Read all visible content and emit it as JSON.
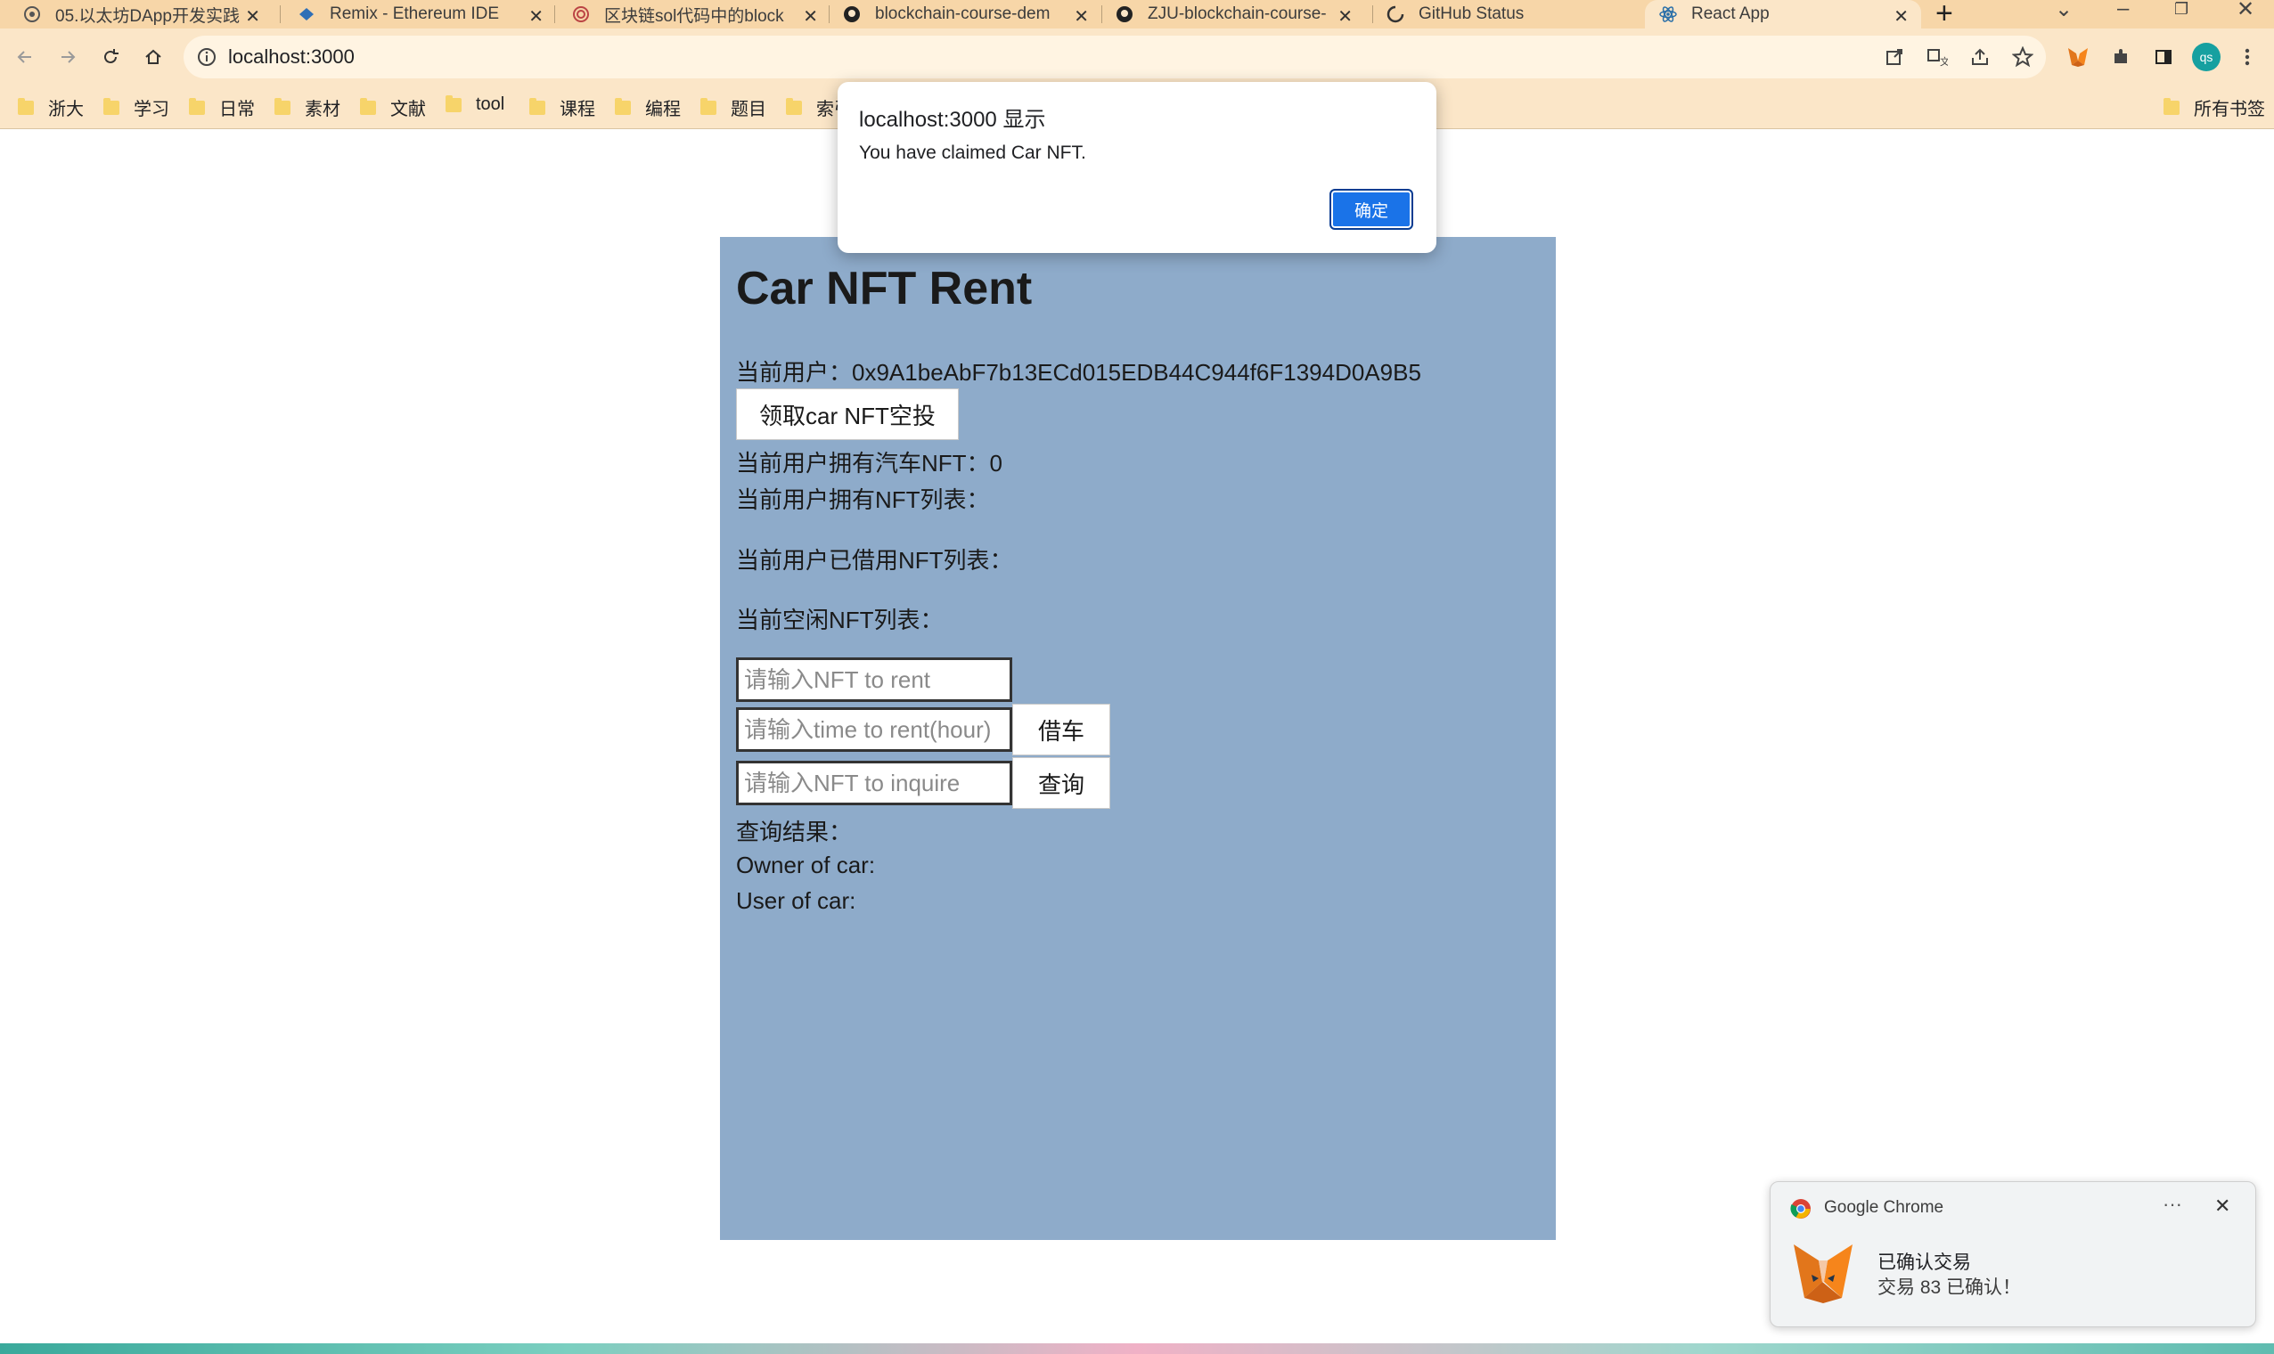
{
  "browser": {
    "tabs": [
      {
        "title": "05.以太坊DApp开发实践",
        "icon": "remix-logo-icon"
      },
      {
        "title": "Remix - Ethereum IDE",
        "icon": "remix-icon"
      },
      {
        "title": "区块链sol代码中的block",
        "icon": "spiral-icon"
      },
      {
        "title": "blockchain-course-dem",
        "icon": "github-icon"
      },
      {
        "title": "ZJU-blockchain-course-",
        "icon": "github-icon"
      },
      {
        "title": "GitHub Status",
        "icon": "github-status-icon"
      },
      {
        "title": "React App",
        "icon": "react-icon",
        "active": true
      }
    ],
    "url": "localhost:3000",
    "profile_initials": "qs",
    "bookmarks": [
      "浙大",
      "学习",
      "日常",
      "素材",
      "文献",
      "tool",
      "课程",
      "编程",
      "题目",
      "索引"
    ],
    "all_bookmarks_label": "所有书签"
  },
  "app": {
    "title": "Car NFT Rent",
    "current_user_label": "当前用户：",
    "current_user_address": "0x9A1beAbF7b13ECd015EDB44C944f6F1394D0A9B5",
    "claim_button": "领取car NFT空投",
    "owned_count_label": "当前用户拥有汽车NFT：",
    "owned_count": "0",
    "owned_list_label": "当前用户拥有NFT列表：",
    "borrowed_list_label": "当前用户已借用NFT列表：",
    "idle_list_label": "当前空闲NFT列表：",
    "rent_nft_placeholder": "请输入NFT to rent",
    "rent_time_placeholder": "请输入time to rent(hour)",
    "rent_button": "借车",
    "inquire_placeholder": "请输入NFT to inquire",
    "inquire_button": "查询",
    "query_result_label": "查询结果：",
    "owner_label": "Owner of car:",
    "user_label": "User of car:"
  },
  "dialog": {
    "origin": "localhost:3000 显示",
    "message": "You have claimed Car NFT.",
    "ok_button": "确定"
  },
  "notification": {
    "app": "Google Chrome",
    "title": "已确认交易",
    "body": "交易 83 已确认！"
  },
  "colors": {
    "app_background": "#8eabca",
    "dialog_button": "#1a73e8",
    "tab_strip": "#f7d6a8",
    "toolbar": "#fbe6c8"
  }
}
